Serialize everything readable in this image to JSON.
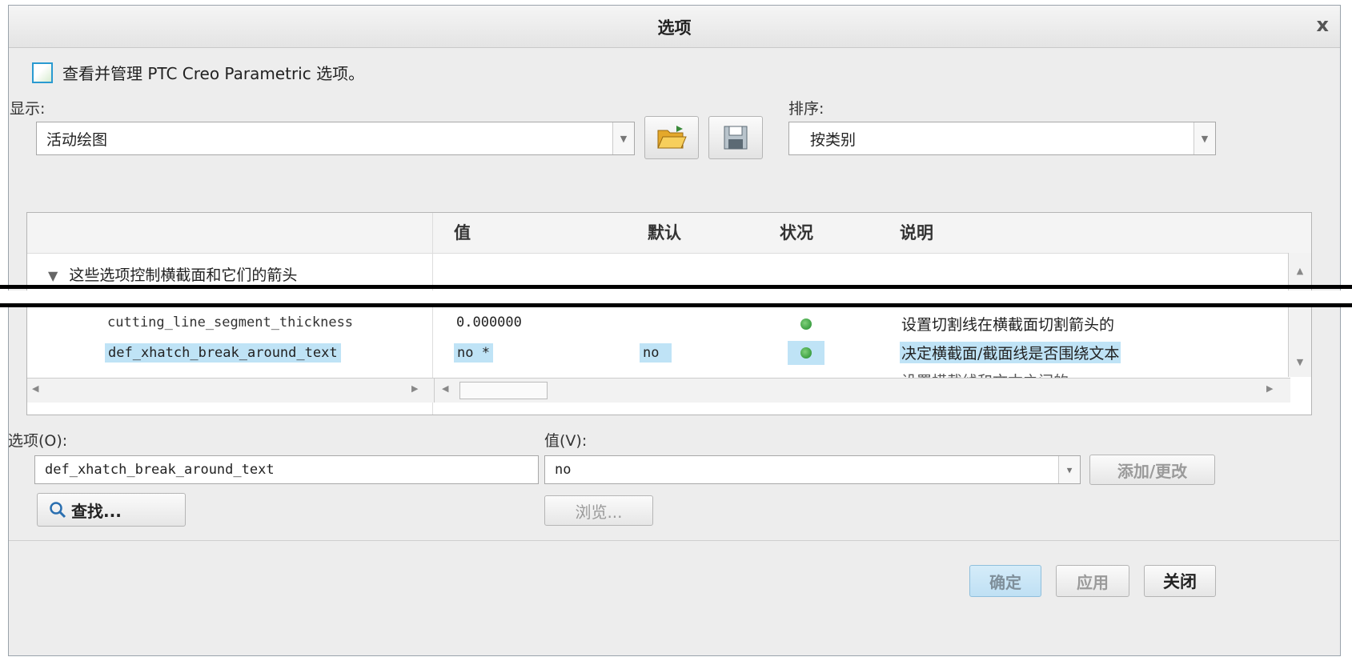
{
  "dialog": {
    "title": "选项",
    "close_glyph": "x"
  },
  "intro": {
    "text": "查看并管理 PTC Creo Parametric 选项。"
  },
  "show": {
    "label": "显示:",
    "value": "活动绘图"
  },
  "sort": {
    "label": "排序:",
    "value": "按类别"
  },
  "toolbar": {
    "open_icon": "folder-open-icon",
    "save_icon": "save-icon"
  },
  "table": {
    "columns": {
      "name": "",
      "value": "值",
      "default": "默认",
      "status": "状况",
      "desc": "说明"
    },
    "group": {
      "toggle": "▼",
      "label": "这些选项控制横截面和它们的箭头"
    },
    "rows": [
      {
        "name": "cutting_line_segment_thickness",
        "value": "0.000000",
        "default": "",
        "desc": "设置切割线在横截面切割箭头的"
      },
      {
        "name": "def_xhatch_break_around_text",
        "value": "no *",
        "default": "no",
        "desc": "决定横截面/截面线是否围绕文本"
      },
      {
        "name": "",
        "value": "",
        "default": "",
        "desc": "设置横截线和文本之间的"
      }
    ]
  },
  "option_field": {
    "label": "选项(O):",
    "value": "def_xhatch_break_around_text"
  },
  "value_field": {
    "label": "值(V):",
    "value": "no"
  },
  "buttons": {
    "add_change": "添加/更改",
    "find": "查找...",
    "browse": "浏览...",
    "ok": "确定",
    "apply": "应用",
    "close": "关闭"
  },
  "colors": {
    "selection": "#bfe3f6",
    "status_dot": "#2e9a36"
  }
}
